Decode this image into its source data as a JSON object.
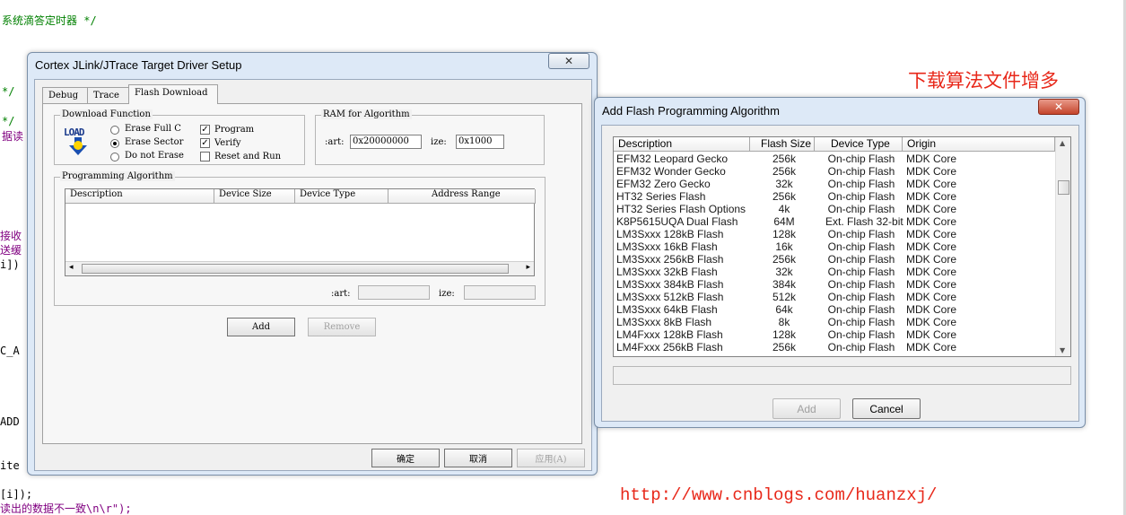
{
  "background_code": [
    {
      "text": "系统滴答定时器 */",
      "color": "green"
    },
    {
      "text": "*/",
      "color": "green"
    },
    {
      "text": "*/",
      "color": "green"
    },
    {
      "text": "据读",
      "color": "purple"
    },
    {
      "text": "接收",
      "color": "purple"
    },
    {
      "text": "送缓",
      "color": "purple"
    },
    {
      "text": "i])",
      "color": "black"
    },
    {
      "text": "C_A",
      "color": "black"
    },
    {
      "text": "ADD",
      "color": "black"
    },
    {
      "text": "ite",
      "color": "black"
    },
    {
      "text": "[i]);",
      "color": "black"
    },
    {
      "text": "读出的数据不一致\\n\\r\");",
      "color": "purple"
    }
  ],
  "setup_dialog": {
    "title": "Cortex JLink/JTrace Target Driver Setup",
    "tabs": [
      "Debug",
      "Trace",
      "Flash Download"
    ],
    "active_tab": "Flash Download",
    "download_function": {
      "label": "Download Function",
      "logo_text": "LOAD",
      "radios": [
        {
          "label": "Erase Full C",
          "selected": false
        },
        {
          "label": "Erase Sector",
          "selected": true
        },
        {
          "label": "Do not Erase",
          "selected": false
        }
      ],
      "checks": [
        {
          "label": "Program",
          "checked": true
        },
        {
          "label": "Verify",
          "checked": true
        },
        {
          "label": "Reset and Run",
          "checked": false
        }
      ]
    },
    "ram": {
      "label": "RAM for Algorithm",
      "start_label": ":art:",
      "start_value": "0x20000000",
      "size_label": "ize:",
      "size_value": "0x1000"
    },
    "programming_algorithm": {
      "label": "Programming Algorithm",
      "columns": [
        "Description",
        "Device Size",
        "Device Type",
        "Address Range"
      ],
      "start_label": ":art:",
      "size_label": "ize:"
    },
    "buttons": {
      "add": "Add",
      "remove": "Remove",
      "ok": "确定",
      "cancel": "取消",
      "apply": "应用(A)"
    }
  },
  "algo_dialog": {
    "title": "Add Flash Programming Algorithm",
    "columns": [
      "Description",
      "Flash Size",
      "Device Type",
      "Origin"
    ],
    "rows": [
      [
        "EFM32 Leopard Gecko",
        "256k",
        "On-chip Flash",
        "MDK Core"
      ],
      [
        "EFM32 Wonder Gecko",
        "256k",
        "On-chip Flash",
        "MDK Core"
      ],
      [
        "EFM32 Zero Gecko",
        "32k",
        "On-chip Flash",
        "MDK Core"
      ],
      [
        "HT32 Series Flash",
        "256k",
        "On-chip Flash",
        "MDK Core"
      ],
      [
        "HT32 Series Flash Options",
        "4k",
        "On-chip Flash",
        "MDK Core"
      ],
      [
        "K8P5615UQA Dual Flash",
        "64M",
        "Ext. Flash 32-bit",
        "MDK Core"
      ],
      [
        "LM3Sxxx 128kB Flash",
        "128k",
        "On-chip Flash",
        "MDK Core"
      ],
      [
        "LM3Sxxx 16kB Flash",
        "16k",
        "On-chip Flash",
        "MDK Core"
      ],
      [
        "LM3Sxxx 256kB Flash",
        "256k",
        "On-chip Flash",
        "MDK Core"
      ],
      [
        "LM3Sxxx 32kB Flash",
        "32k",
        "On-chip Flash",
        "MDK Core"
      ],
      [
        "LM3Sxxx 384kB Flash",
        "384k",
        "On-chip Flash",
        "MDK Core"
      ],
      [
        "LM3Sxxx 512kB Flash",
        "512k",
        "On-chip Flash",
        "MDK Core"
      ],
      [
        "LM3Sxxx 64kB Flash",
        "64k",
        "On-chip Flash",
        "MDK Core"
      ],
      [
        "LM3Sxxx 8kB Flash",
        "8k",
        "On-chip Flash",
        "MDK Core"
      ],
      [
        "LM4Fxxx 128kB Flash",
        "128k",
        "On-chip Flash",
        "MDK Core"
      ],
      [
        "LM4Fxxx 256kB Flash",
        "256k",
        "On-chip Flash",
        "MDK Core"
      ]
    ],
    "buttons": {
      "add": "Add",
      "cancel": "Cancel"
    }
  },
  "annotation": "下载算法文件增多",
  "watermark_url": "http://www.cnblogs.com/huanzxj/",
  "colors": {
    "annotation": "#e8281a",
    "comment_green": "#008000",
    "string_purple": "#800080"
  }
}
